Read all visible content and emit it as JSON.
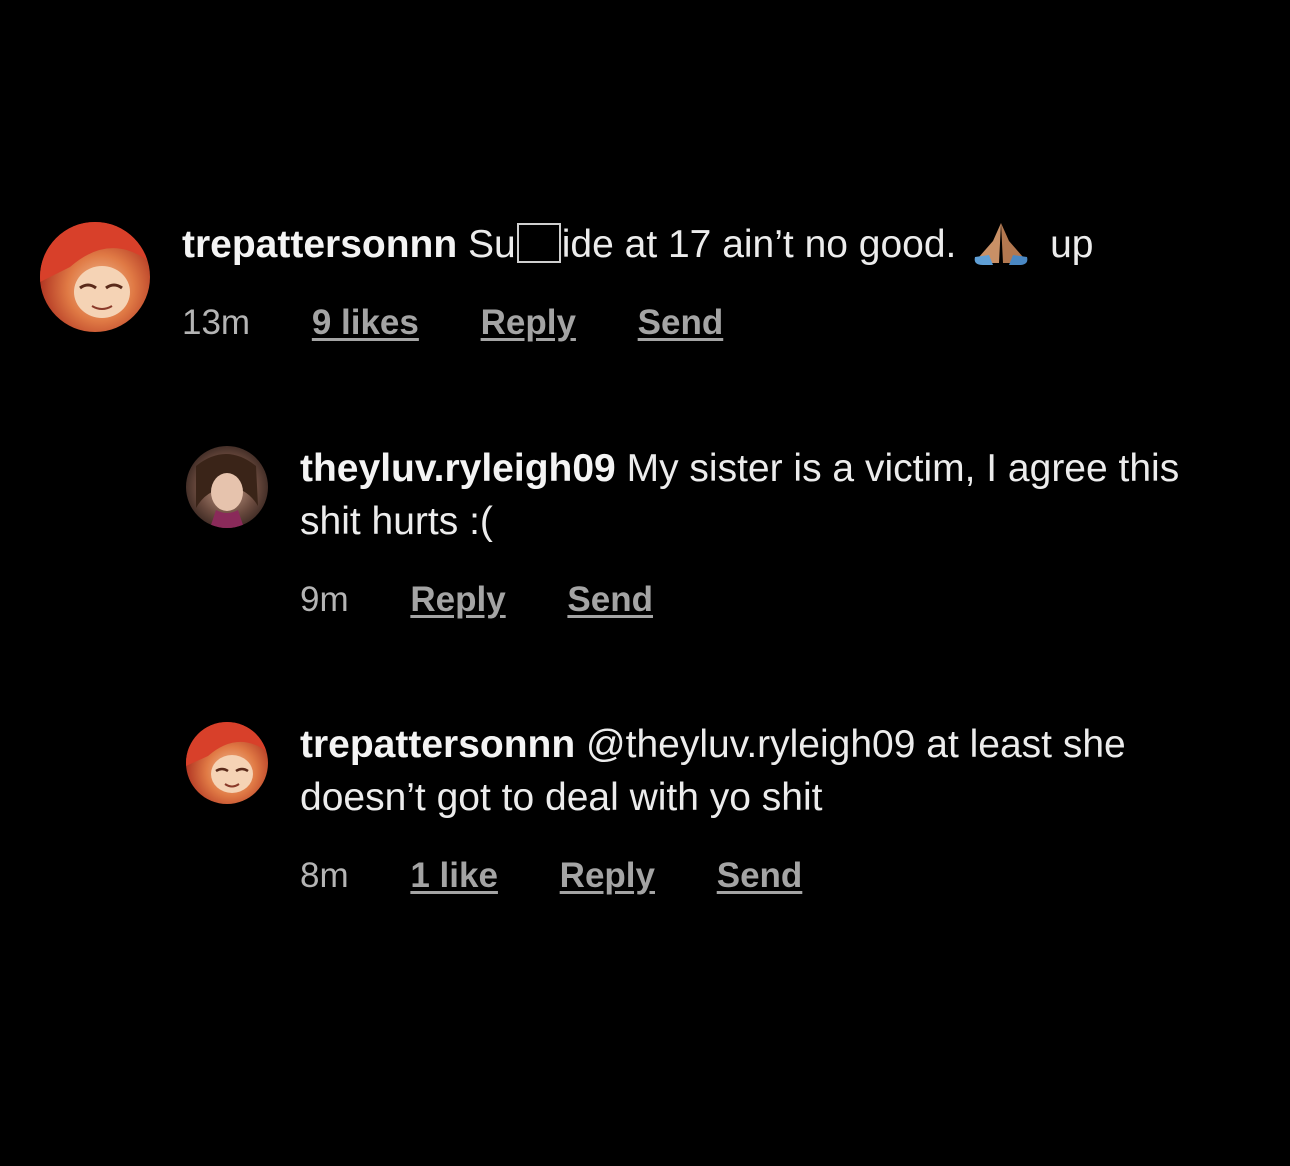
{
  "comments": [
    {
      "username": "trepattersonnn",
      "text_before": "Su",
      "text_after": "ide at 17 ain’t no good.",
      "text_tail": "up",
      "emoji_icon": "folded-hands-icon",
      "time": "13m",
      "likes": "9 likes",
      "reply": "Reply",
      "send": "Send"
    },
    {
      "username": "theyluv.ryleigh09",
      "text": "My sister is a victim, I agree this shit hurts :(",
      "time": "9m",
      "reply": "Reply",
      "send": "Send"
    },
    {
      "username": "trepattersonnn",
      "mention": "@theyluv.ryleigh09",
      "text": "at least she doesn’t got to deal with yo shit",
      "time": "8m",
      "likes": "1 like",
      "reply": "Reply",
      "send": "Send"
    }
  ],
  "colors": {
    "background": "#000000",
    "text": "#ececec",
    "meta": "#a8a8a8"
  }
}
